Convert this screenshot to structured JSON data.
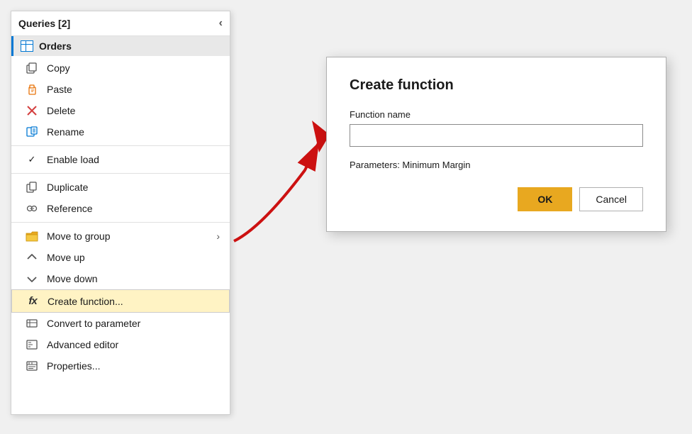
{
  "panel": {
    "title": "Queries [2]",
    "collapse_label": "‹",
    "orders_label": "Orders"
  },
  "menu": {
    "items": [
      {
        "id": "copy",
        "label": "Copy",
        "icon": "copy",
        "indent": true
      },
      {
        "id": "paste",
        "label": "Paste",
        "icon": "paste",
        "indent": true
      },
      {
        "id": "delete",
        "label": "Delete",
        "icon": "delete",
        "indent": true
      },
      {
        "id": "rename",
        "label": "Rename",
        "icon": "rename",
        "indent": true
      },
      {
        "id": "enable-load",
        "label": "Enable load",
        "icon": "check",
        "indent": false
      },
      {
        "id": "duplicate",
        "label": "Duplicate",
        "icon": "duplicate",
        "indent": true
      },
      {
        "id": "reference",
        "label": "Reference",
        "icon": "reference",
        "indent": true
      },
      {
        "id": "move-to-group",
        "label": "Move to group",
        "icon": "folder",
        "indent": true,
        "hasSubmenu": true
      },
      {
        "id": "move-up",
        "label": "Move up",
        "icon": "moveup",
        "indent": true
      },
      {
        "id": "move-down",
        "label": "Move down",
        "icon": "movedown",
        "indent": true
      },
      {
        "id": "create-function",
        "label": "Create function...",
        "icon": "fx",
        "indent": true,
        "highlighted": true
      },
      {
        "id": "convert-to-parameter",
        "label": "Convert to parameter",
        "icon": "convert",
        "indent": true
      },
      {
        "id": "advanced-editor",
        "label": "Advanced editor",
        "icon": "advanced",
        "indent": true
      },
      {
        "id": "properties",
        "label": "Properties...",
        "icon": "properties",
        "indent": true
      }
    ]
  },
  "dialog": {
    "title": "Create function",
    "function_name_label": "Function name",
    "function_name_placeholder": "",
    "params_label": "Parameters: Minimum Margin",
    "ok_label": "OK",
    "cancel_label": "Cancel"
  }
}
